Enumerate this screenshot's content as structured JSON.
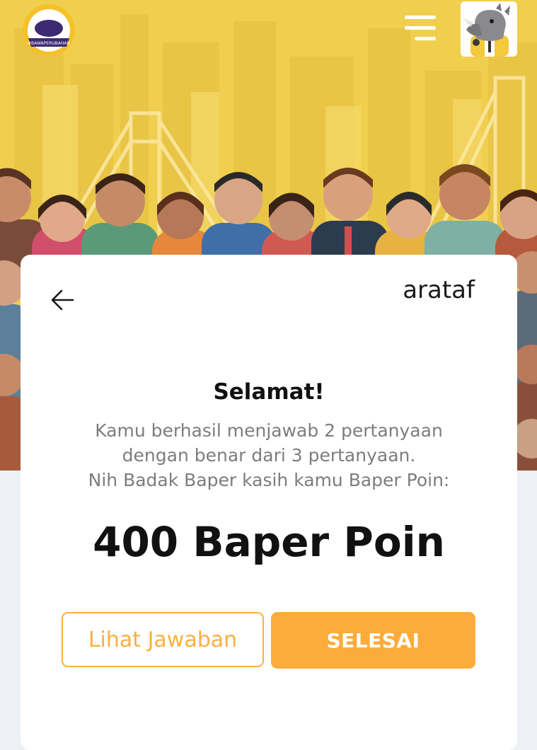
{
  "header": {
    "logo_label": "Klub Sobat Badak",
    "logo_tagline": "#BAWAPERUBAHAN",
    "menu_icon": "hamburger-menu-icon",
    "avatar_icon": "rhino-mascot-avatar"
  },
  "result": {
    "username": "arataf",
    "title": "Selamat!",
    "message_lines": [
      "Kamu berhasil menjawab 2 pertanyaan",
      "dengan benar dari 3 pertanyaan.",
      "Nih Badak Baper kasih kamu Baper Poin:"
    ],
    "points_text": "400 Baper Poin",
    "secondary_button": "Lihat Jawaban",
    "primary_button": "SELESAI"
  },
  "colors": {
    "accent": "#fbb040",
    "hero_yellow": "#f1cf4e",
    "page_bg": "#eef0f8"
  }
}
